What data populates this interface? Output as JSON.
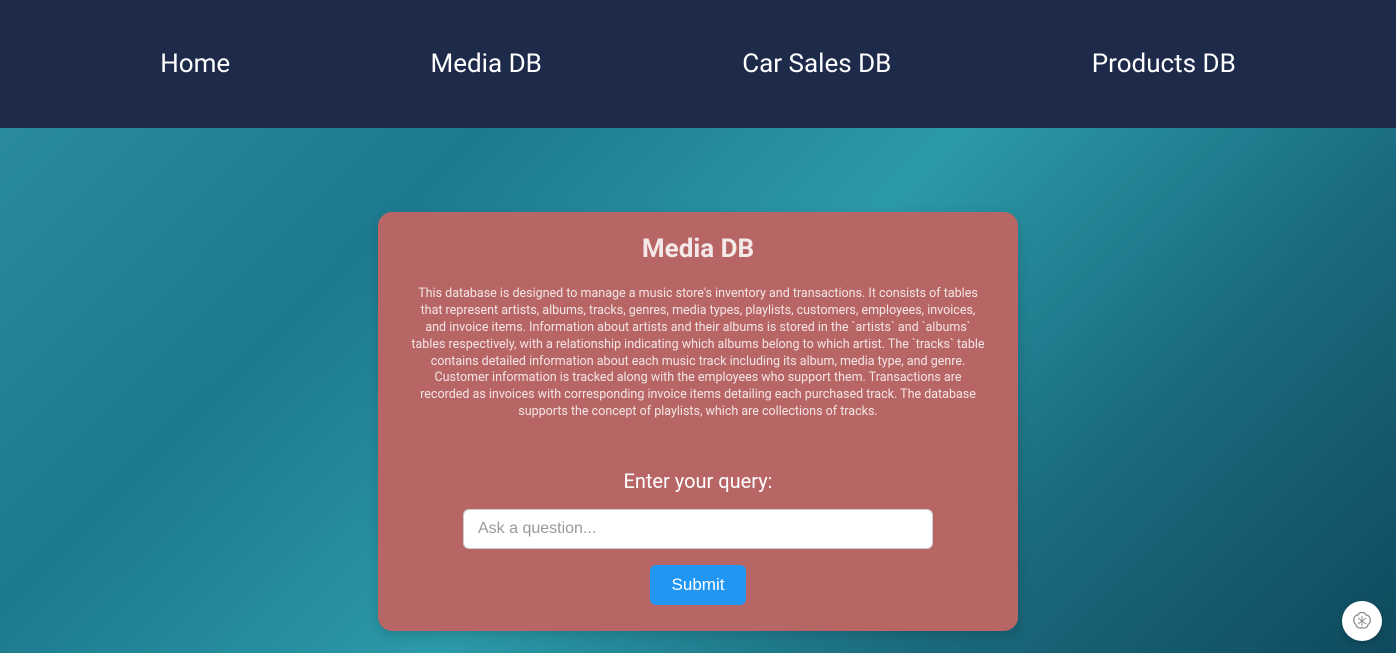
{
  "nav": {
    "items": [
      {
        "label": "Home"
      },
      {
        "label": "Media DB"
      },
      {
        "label": "Car Sales DB"
      },
      {
        "label": "Products DB"
      }
    ]
  },
  "card": {
    "title": "Media DB",
    "description": "This database is designed to manage a music store's inventory and transactions. It consists of tables that represent artists, albums, tracks, genres, media types, playlists, customers, employees, invoices, and invoice items. Information about artists and their albums is stored in the `artists` and `albums` tables respectively, with a relationship indicating which albums belong to which artist. The `tracks` table contains detailed information about each music track including its album, media type, and genre. Customer information is tracked along with the employees who support them. Transactions are recorded as invoices with corresponding invoice items detailing each purchased track. The database supports the concept of playlists, which are collections of tracks.",
    "query_label": "Enter your query:",
    "input_placeholder": "Ask a question...",
    "submit_label": "Submit"
  },
  "floating_icon": "openai-icon"
}
